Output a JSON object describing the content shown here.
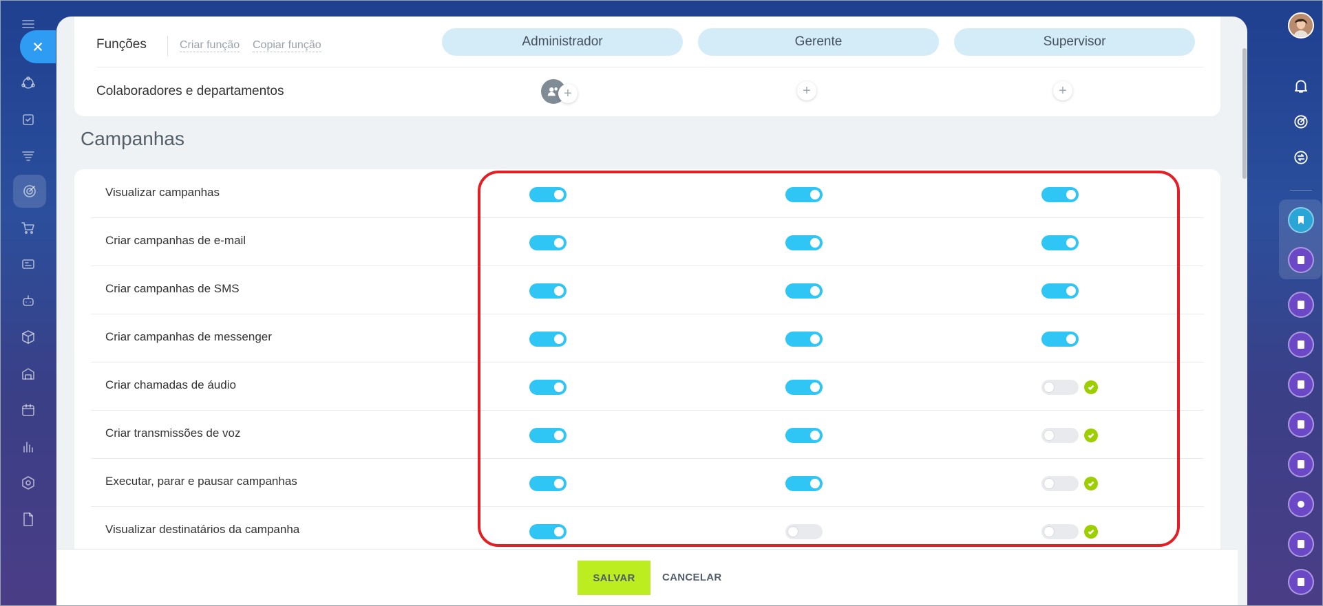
{
  "header": {
    "title": "Funções",
    "links": [
      "Criar função",
      "Copiar função"
    ]
  },
  "roles": [
    "Administrador",
    "Gerente",
    "Supervisor"
  ],
  "assignees_label": "Colaboradores e departamentos",
  "section_title": "Campanhas",
  "permissions": [
    {
      "label": "Visualizar campanhas",
      "values": [
        true,
        true,
        true
      ],
      "check": [
        false,
        false,
        false
      ]
    },
    {
      "label": "Criar campanhas de e-mail",
      "values": [
        true,
        true,
        true
      ],
      "check": [
        false,
        false,
        false
      ]
    },
    {
      "label": "Criar campanhas de SMS",
      "values": [
        true,
        true,
        true
      ],
      "check": [
        false,
        false,
        false
      ]
    },
    {
      "label": "Criar campanhas de messenger",
      "values": [
        true,
        true,
        true
      ],
      "check": [
        false,
        false,
        false
      ]
    },
    {
      "label": "Criar chamadas de áudio",
      "values": [
        true,
        true,
        false
      ],
      "check": [
        false,
        false,
        true
      ]
    },
    {
      "label": "Criar transmissões de voz",
      "values": [
        true,
        true,
        false
      ],
      "check": [
        false,
        false,
        true
      ]
    },
    {
      "label": "Executar, parar e pausar campanhas",
      "values": [
        true,
        true,
        false
      ],
      "check": [
        false,
        false,
        true
      ]
    },
    {
      "label": "Visualizar destinatários da campanha",
      "values": [
        true,
        false,
        false
      ],
      "check": [
        false,
        false,
        true
      ]
    }
  ],
  "footer": {
    "save_label": "SALVAR",
    "cancel_label": "CANCELAR"
  },
  "colors": {
    "toggle_on": "#2fc6f6",
    "toggle_off": "#e8eaed",
    "check": "#9dcf00",
    "highlight": "#e31e24",
    "save_button": "#bbed21"
  },
  "icons": {
    "left_sidebar": [
      "menu-icon",
      "close-icon",
      "crm-icon",
      "tasks-icon",
      "funnel-icon",
      "target-icon",
      "cart-icon",
      "contact-center-icon",
      "robot-icon",
      "box-icon",
      "warehouse-icon",
      "calendar-icon",
      "analytics-icon",
      "settings-hex-icon",
      "document-icon"
    ],
    "right_sidebar": [
      "avatar",
      "bell-icon",
      "target-icon",
      "sync-chat-icon",
      "bookmark-icon",
      "contact-icon"
    ]
  }
}
